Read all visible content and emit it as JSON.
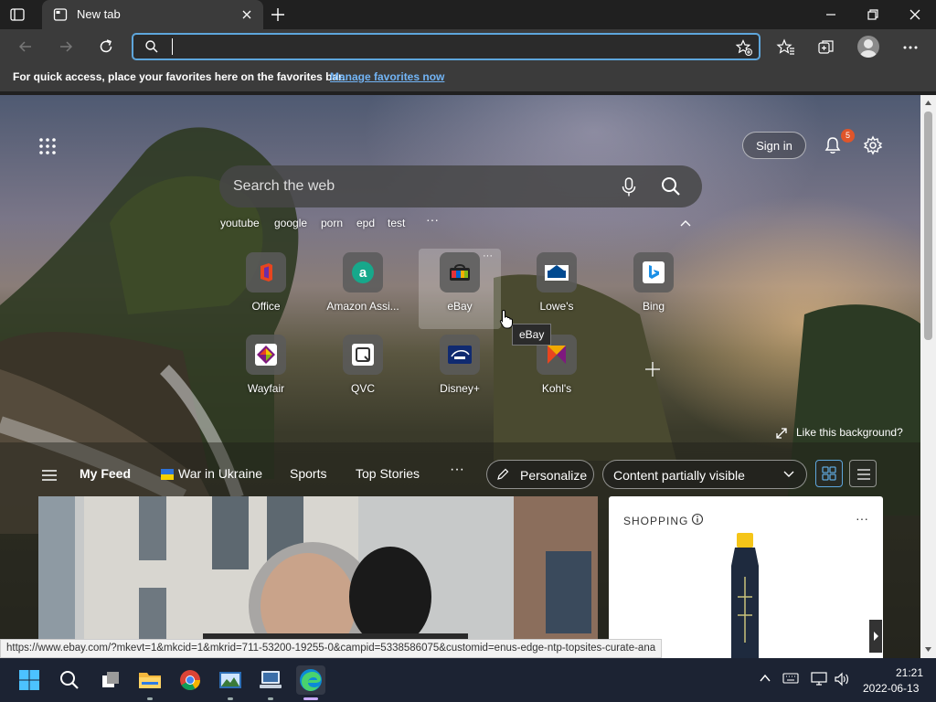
{
  "browser": {
    "tab_title": "New tab",
    "address_value": "",
    "favorites_bar": {
      "message": "For quick access, place your favorites here on the favorites bar.",
      "link": "Manage favorites now"
    }
  },
  "ntp": {
    "signin_label": "Sign in",
    "notification_count": "5",
    "search_placeholder": "Search the web",
    "suggestions": [
      "youtube",
      "google",
      "porn",
      "epd",
      "test"
    ],
    "suggestions_more": "···",
    "tiles": [
      {
        "label": "Office",
        "icon": "office-icon"
      },
      {
        "label": "Amazon Assi...",
        "icon": "amazon-icon"
      },
      {
        "label": "eBay",
        "icon": "ebay-icon"
      },
      {
        "label": "Lowe's",
        "icon": "lowes-icon"
      },
      {
        "label": "Bing",
        "icon": "bing-icon"
      },
      {
        "label": "Wayfair",
        "icon": "wayfair-icon"
      },
      {
        "label": "QVC",
        "icon": "qvc-icon"
      },
      {
        "label": "Disney+",
        "icon": "disney-icon"
      },
      {
        "label": "Kohl's",
        "icon": "kohls-icon"
      }
    ],
    "tile_more": "···",
    "tooltip": "eBay",
    "like_background": "Like this background?",
    "feed": {
      "tabs": [
        "My Feed",
        "War in Ukraine",
        "Sports",
        "Top Stories"
      ],
      "more": "···",
      "personalize_label": "Personalize",
      "content_filter": "Content partially visible"
    },
    "shopping": {
      "title": "SHOPPING",
      "more": "···"
    }
  },
  "status_url": "https://www.ebay.com/?mkevt=1&mkcid=1&mkrid=711-53200-19255-0&campid=5338586075&customid=enus-edge-ntp-topsites-curate-ana",
  "taskbar": {
    "time": "21:21",
    "date": "2022-06-13"
  },
  "colors": {
    "accent": "#5ea6dc",
    "link": "#72b4f5",
    "badge": "#e0552a",
    "chrome_bg": "#202020",
    "toolbar_bg": "#3b3b3b",
    "taskbar_bg": "#1c2333"
  }
}
